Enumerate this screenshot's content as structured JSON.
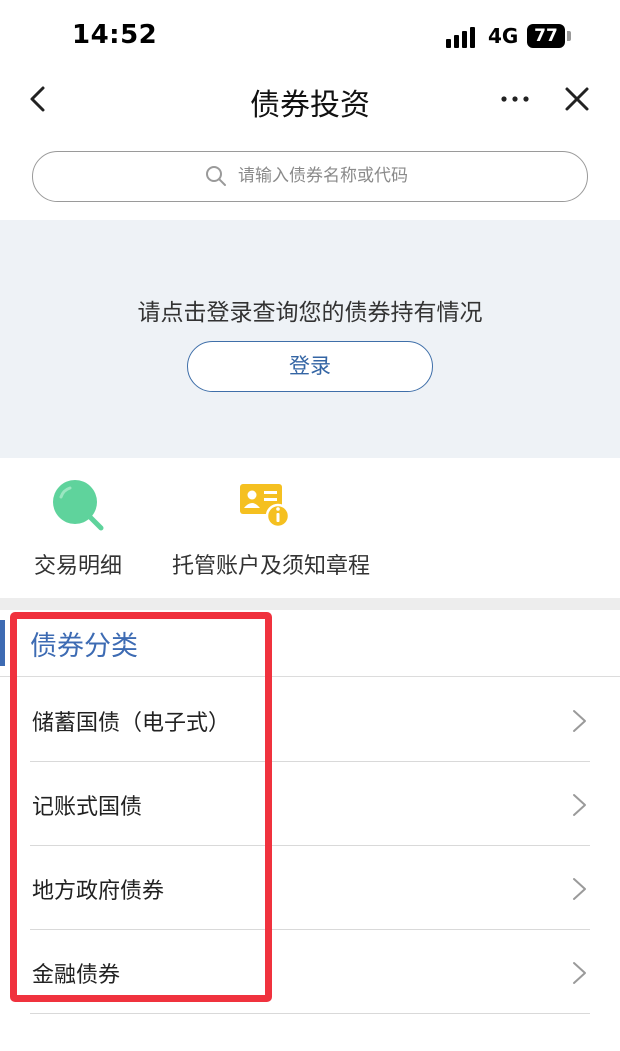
{
  "status_bar": {
    "time": "14:52",
    "network": "4G",
    "battery": "77"
  },
  "nav": {
    "title": "债券投资"
  },
  "search": {
    "placeholder": "请输入债券名称或代码"
  },
  "login_panel": {
    "prompt": "请点击登录查询您的债券持有情况",
    "button_label": "登录"
  },
  "shortcuts": [
    {
      "label": "交易明细",
      "icon": "search-magnifier-icon",
      "color": "#5fd39c"
    },
    {
      "label": "托管账户及须知章程",
      "icon": "account-info-card-icon",
      "color": "#f5c020"
    }
  ],
  "categories": {
    "title": "债券分类",
    "items": [
      {
        "label": "储蓄国债（电子式）"
      },
      {
        "label": "记账式国债"
      },
      {
        "label": "地方政府债券"
      },
      {
        "label": "金融债券"
      }
    ]
  },
  "colors": {
    "accent": "#3d6bb3",
    "highlight": "#f0323e",
    "panel_bg": "#eef2f6"
  }
}
